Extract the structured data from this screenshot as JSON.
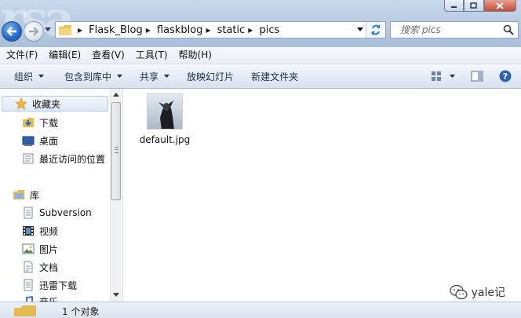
{
  "window": {
    "background_text": "rsa"
  },
  "address_bar": {
    "path": [
      "Flask_Blog",
      "flaskblog",
      "static",
      "pics"
    ]
  },
  "search": {
    "placeholder": "搜索 pics"
  },
  "menu": {
    "items": [
      "文件(F)",
      "编辑(E)",
      "查看(V)",
      "工具(T)",
      "帮助(H)"
    ]
  },
  "commands": {
    "organize": "组织",
    "include_in_library": "包含到库中",
    "share": "共享",
    "slideshow": "放映幻灯片",
    "new_folder": "新建文件夹"
  },
  "sidebar": {
    "favorites": "收藏夹",
    "downloads": "下载",
    "desktop": "桌面",
    "recent": "最近访问的位置",
    "libraries": "库",
    "subversion": "Subversion",
    "videos": "视频",
    "pictures": "图片",
    "documents": "文档",
    "thunder_downloads": "迅雷下载",
    "music": "音乐"
  },
  "files": [
    {
      "name": "default.jpg"
    }
  ],
  "watermark": {
    "text": "yale记"
  },
  "status": {
    "count": "1 个对象"
  },
  "colors": {
    "accent": "#2b6cc8",
    "titlebar": "#b9cde3",
    "close": "#c74a37"
  }
}
